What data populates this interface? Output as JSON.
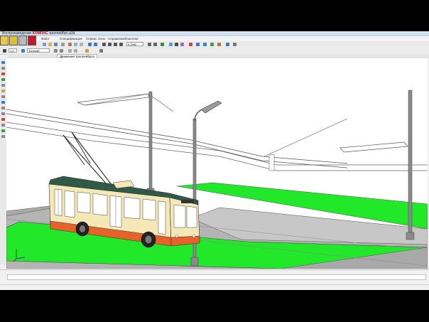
{
  "window": {
    "title_prefix": "Воспроизведение",
    "title_brand": "КОМПАС",
    "title_file": "троллейбус.a3d"
  },
  "menu": [
    "Файл",
    "Спецификация",
    "Сервис",
    "Окно",
    "Справка",
    "Библиотеки"
  ],
  "toolbar": {
    "zoom_value": "0.2992",
    "line_style": "Толстый",
    "step_value": "1.0"
  },
  "document_tab": {
    "label": "Движение троллейбуса"
  },
  "scene": {
    "description_colors": {
      "grass": "#22e82a",
      "road": "#a9a9a9",
      "body": "#f3e8b6",
      "roof": "#2f5a46",
      "stripe": "#e5622a",
      "pole": "#8a8a8a"
    }
  }
}
